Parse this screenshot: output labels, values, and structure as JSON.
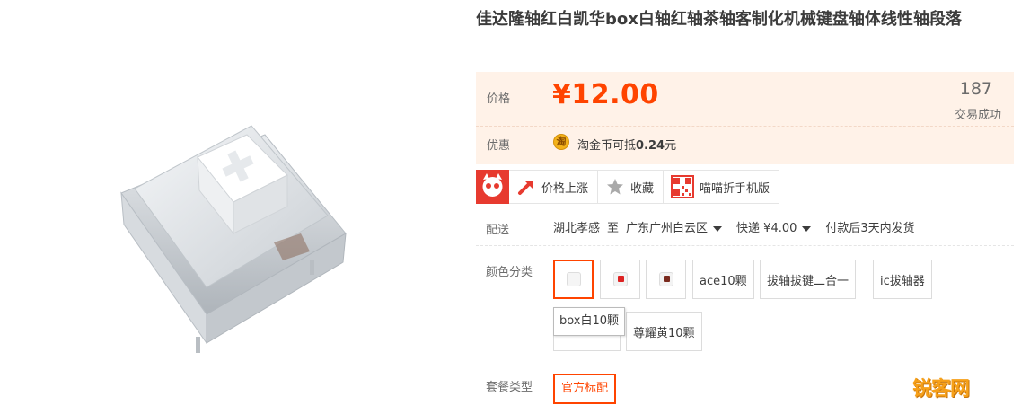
{
  "product": {
    "title": "佳达隆轴红白凯华box白轴红轴茶轴客制化机械键盘轴体线性轴段落"
  },
  "price": {
    "label": "价格",
    "value": "¥12.00",
    "sales_count": "187",
    "sales_label": "交易成功",
    "promo_label": "优惠",
    "coin_icon_text": "淘",
    "promo_prefix": "淘金币可抵",
    "promo_amount": "0.24",
    "promo_suffix": "元"
  },
  "actions": {
    "price_alert": "价格上涨",
    "favorite": "收藏",
    "mobile": "喵喵折手机版"
  },
  "delivery": {
    "label": "配送",
    "from": "湖北孝感",
    "to_word": "至",
    "destination": "广东广州白云区",
    "shipping": "快递 ¥4.00",
    "dispatch": "付款后3天内发货"
  },
  "sku": {
    "label": "颜色分类",
    "options": [
      "",
      "",
      "",
      "ace10颗",
      "拔轴拔键二合一",
      "ic拔轴器",
      "",
      "尊耀黄10颗"
    ],
    "tooltip": "box白10颗"
  },
  "package": {
    "label": "套餐类型",
    "option": "官方标配"
  },
  "watermark": "锐客网",
  "colors": {
    "accent": "#ff4400",
    "panel_bg": "#fff2e8"
  }
}
